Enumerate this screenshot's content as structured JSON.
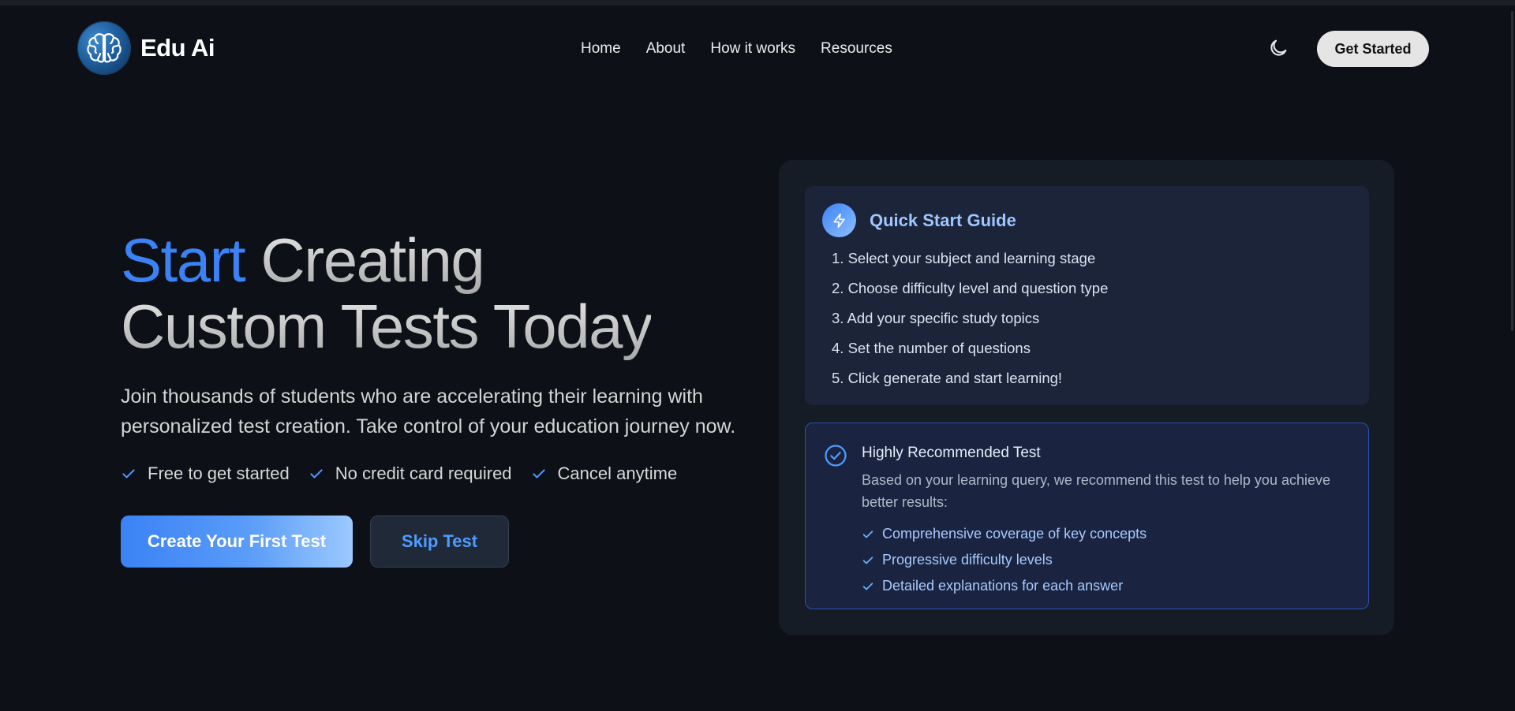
{
  "nav": {
    "brand": "Edu Ai",
    "links": [
      "Home",
      "About",
      "How it works",
      "Resources"
    ],
    "cta": "Get Started"
  },
  "hero": {
    "title_accent": "Start",
    "title_line1_rest": "Creating",
    "title_line2": "Custom Tests Today",
    "subtitle": "Join thousands of students who are accelerating their learning with personalized test creation. Take control of your education journey now.",
    "bullets": [
      "Free to get started",
      "No credit card required",
      "Cancel anytime"
    ],
    "primary_button": "Create Your First Test",
    "secondary_button": "Skip Test"
  },
  "guide": {
    "title": "Quick Start Guide",
    "steps": [
      "1. Select your subject and learning stage",
      "2. Choose difficulty level and question type",
      "3. Add your specific study topics",
      "4. Set the number of questions",
      "5. Click generate and start learning!"
    ]
  },
  "recommendation": {
    "title": "Highly Recommended Test",
    "description": "Based on your learning query, we recommend this test to help you achieve better results:",
    "points": [
      "Comprehensive coverage of key concepts",
      "Progressive difficulty levels",
      "Detailed explanations for each answer"
    ]
  },
  "colors": {
    "background": "#0d1117",
    "accent": "#3b82f6",
    "card": "#161c26"
  },
  "icons": {
    "logo": "brain-icon",
    "theme": "moon-icon",
    "guide": "lightning-bolt-icon",
    "recommendation": "check-circle-icon",
    "bullet": "checkmark-icon"
  }
}
